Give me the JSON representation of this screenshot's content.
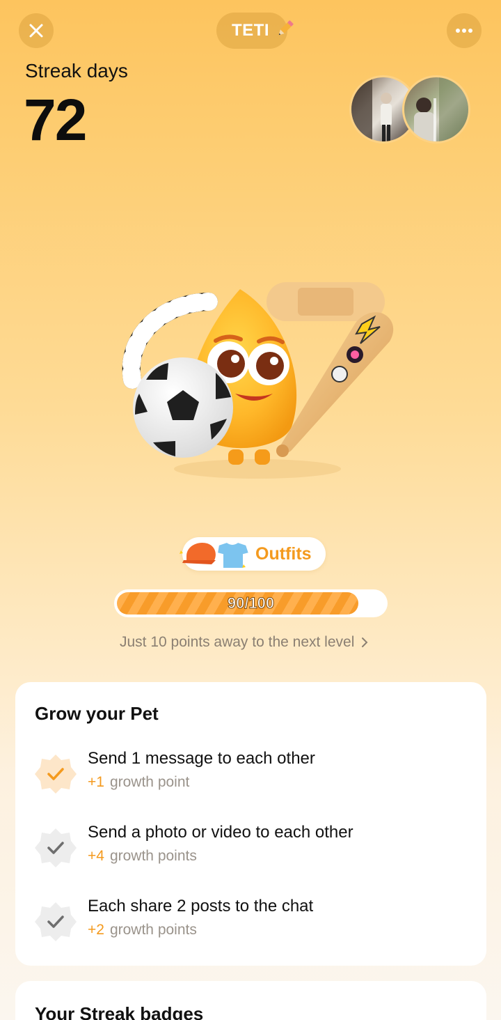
{
  "header": {
    "name": "TETI",
    "close_icon": "close-icon",
    "more_icon": "more-icon",
    "edit_icon": "pencil-icon"
  },
  "streak": {
    "label": "Streak days",
    "value": "72"
  },
  "outfits": {
    "label": "Outfits"
  },
  "progress": {
    "text": "90/100",
    "current": 90,
    "max": 100
  },
  "next_level": {
    "text": "Just 10 points away to the next level"
  },
  "grow": {
    "title": "Grow your Pet",
    "tasks": [
      {
        "title": "Send 1 message to each other",
        "plus": "+1",
        "points_label": "growth point",
        "completed": true
      },
      {
        "title": "Send a photo or video to each other",
        "plus": "+4",
        "points_label": "growth points",
        "completed": false
      },
      {
        "title": "Each share 2 posts to the chat",
        "plus": "+2",
        "points_label": "growth points",
        "completed": false
      }
    ]
  },
  "badges": {
    "title": "Your Streak badges"
  },
  "colors": {
    "accent": "#f49a1e",
    "background_top": "#fdc45e",
    "background_bottom": "#fbf6ef"
  }
}
